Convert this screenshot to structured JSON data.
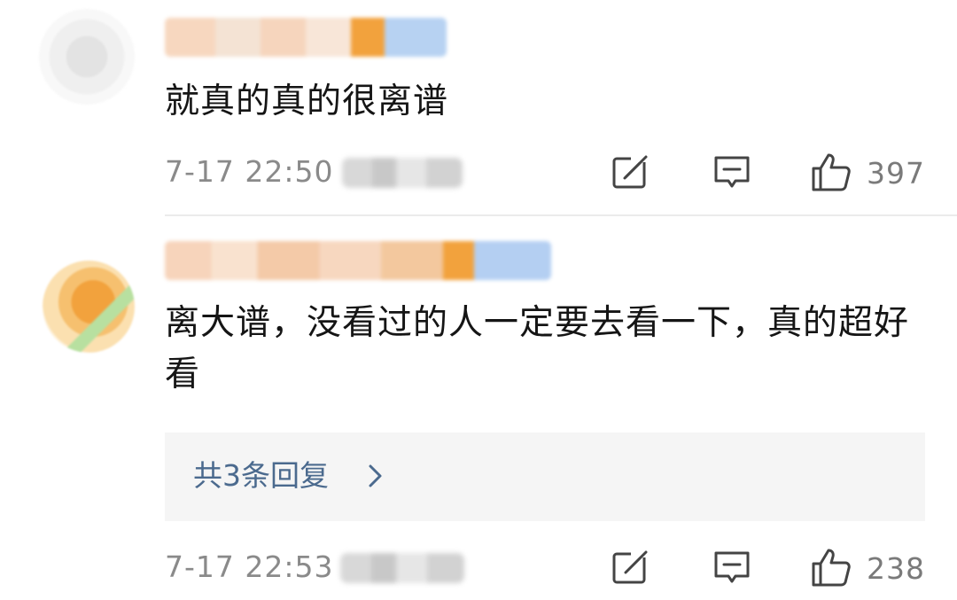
{
  "comments": [
    {
      "text": "就真的真的很离谱",
      "time": "7-17 22:50",
      "likes": "397"
    },
    {
      "text": "离大谱，没看过的人一定要去看一下，真的超好看",
      "replies_label": "共3条回复",
      "time": "7-17 22:53",
      "likes": "238"
    }
  ],
  "icons": {
    "edit": "edit-icon",
    "reply": "comment-icon",
    "like": "thumbs-up-icon",
    "chevron": "chevron-right-icon"
  },
  "colors": {
    "text": "#151515",
    "meta": "#8a8a8a",
    "link": "#4b6a8e",
    "replies_bg": "#f5f5f5"
  }
}
